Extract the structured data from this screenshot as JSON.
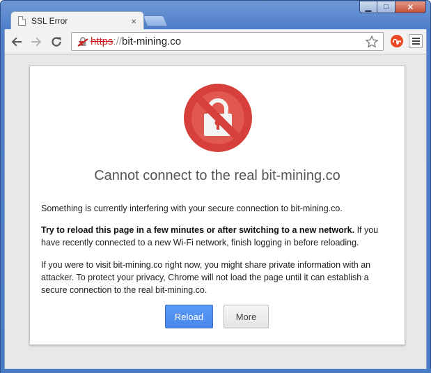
{
  "window": {
    "minimize_glyph": "▁",
    "maximize_glyph": "□",
    "close_glyph": "✕"
  },
  "tab": {
    "title": "SSL Error",
    "close_glyph": "×"
  },
  "omnibox": {
    "protocol": "https",
    "separator": "://",
    "host": "bit-mining.co"
  },
  "icons": {
    "back": "back-arrow-icon",
    "forward": "forward-arrow-icon",
    "reload": "reload-icon",
    "security": "broken-lock-icon",
    "bookmark": "star-icon",
    "extension": "stumbleupon-icon",
    "menu": "hamburger-menu-icon",
    "error": "prohibited-lock-icon"
  },
  "colors": {
    "error_red": "#c9211e",
    "reload_button": "#4a87ee",
    "icon_circle": "#d7403a"
  },
  "page": {
    "heading": "Cannot connect to the real bit-mining.co",
    "para1": "Something is currently interfering with your secure connection to bit-mining.co.",
    "para2_bold": "Try to reload this page in a few minutes or after switching to a new network.",
    "para2_rest": " If you have recently connected to a new Wi-Fi network, finish logging in before reloading.",
    "para3": "If you were to visit bit-mining.co right now, you might share private information with an attacker. To protect your privacy, Chrome will not load the page until it can establish a secure connection to the real bit-mining.co.",
    "reload_label": "Reload",
    "more_label": "More"
  }
}
